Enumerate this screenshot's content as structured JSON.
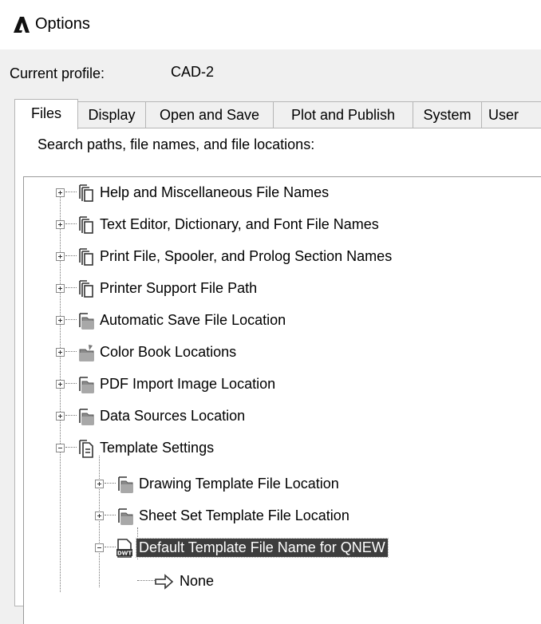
{
  "window": {
    "title": "Options",
    "logo_icon": "autocad-a-logo-icon"
  },
  "profile": {
    "label": "Current profile:",
    "value": "CAD-2"
  },
  "tabs": [
    {
      "label": "Files",
      "active": true
    },
    {
      "label": "Display"
    },
    {
      "label": "Open and Save"
    },
    {
      "label": "Plot and Publish"
    },
    {
      "label": "System"
    },
    {
      "label": "User"
    }
  ],
  "panel": {
    "caption": "Search paths, file names, and file locations:"
  },
  "tree": {
    "items": [
      {
        "label": "Help and Miscellaneous File Names",
        "icon": "file-names-icon",
        "expanded": false
      },
      {
        "label": "Text Editor, Dictionary, and Font File Names",
        "icon": "file-names-icon",
        "expanded": false
      },
      {
        "label": "Print File, Spooler, and Prolog Section Names",
        "icon": "file-names-icon",
        "expanded": false
      },
      {
        "label": "Printer Support File Path",
        "icon": "file-names-icon",
        "expanded": false
      },
      {
        "label": "Automatic Save File Location",
        "icon": "folder-location-icon",
        "expanded": false
      },
      {
        "label": "Color Book Locations",
        "icon": "color-book-folder-icon",
        "expanded": false
      },
      {
        "label": "PDF Import Image Location",
        "icon": "folder-location-icon",
        "expanded": false
      },
      {
        "label": "Data Sources Location",
        "icon": "folder-location-icon",
        "expanded": false
      },
      {
        "label": "Template Settings",
        "icon": "template-settings-icon",
        "expanded": true
      },
      {
        "label": "Drawing Template File Location",
        "icon": "folder-location-icon",
        "expanded": false
      },
      {
        "label": "Sheet Set Template File Location",
        "icon": "folder-location-icon",
        "expanded": false
      },
      {
        "label": "Default Template File Name for QNEW",
        "icon": "dwt-file-icon",
        "expanded": true,
        "selected": true
      },
      {
        "label": "None",
        "icon": "arrow-right-icon"
      }
    ]
  },
  "colors": {
    "selection": "#3d3d3d",
    "window_bg": "#f0f0f0",
    "panel_bg": "#ffffff"
  }
}
